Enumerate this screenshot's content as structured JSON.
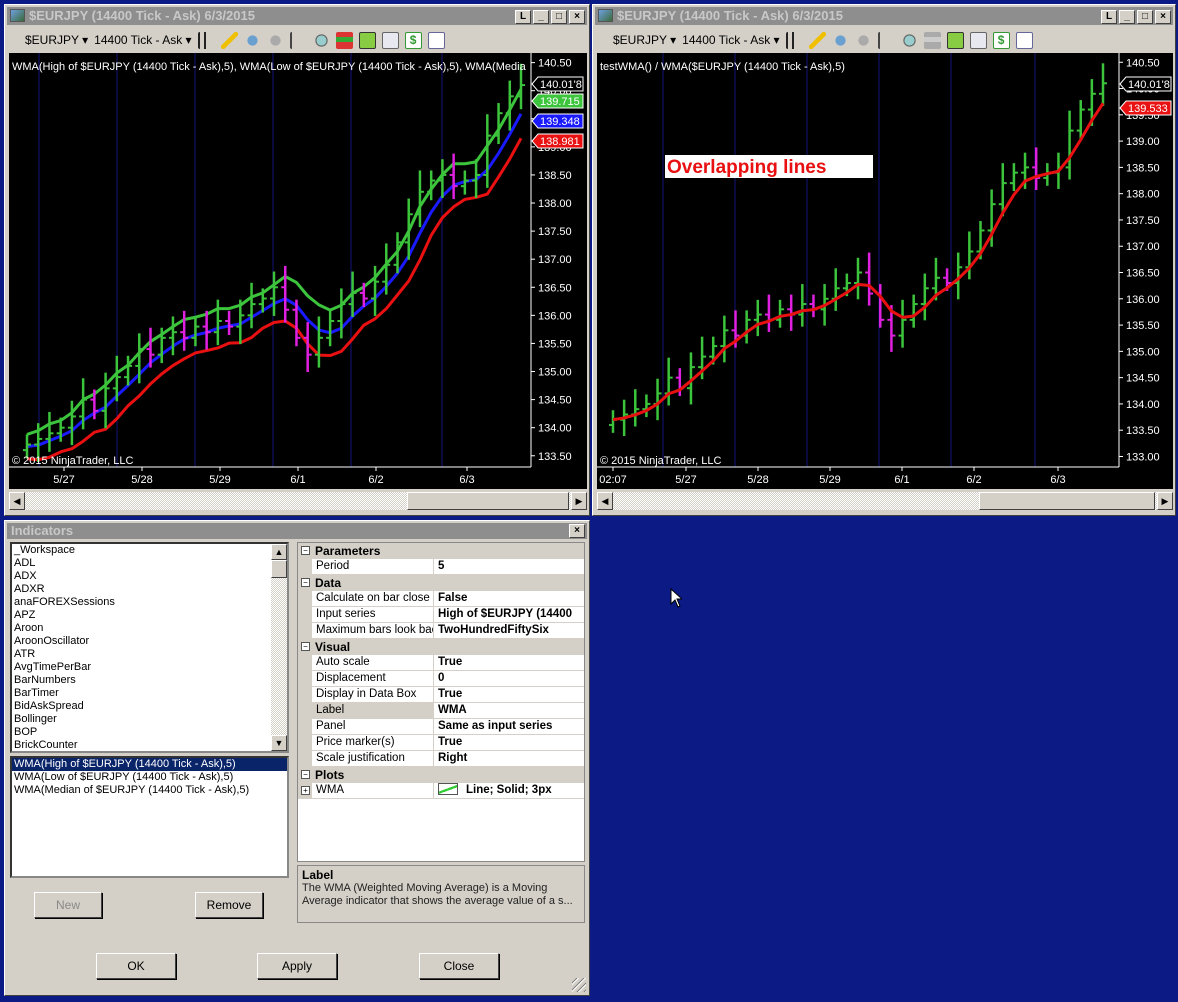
{
  "left_window": {
    "title": "$EURJPY (14400 Tick - Ask)  6/3/2015",
    "instrument": "$EURJPY",
    "interval": "14400 Tick - Ask",
    "legend": "WMA(High of $EURJPY (14400 Tick - Ask),5), WMA(Low of $EURJPY (14400 Tick - Ask),5), WMA(Media",
    "copyright": "© 2015 NinjaTrader, LLC",
    "price_markers": [
      {
        "text": "140.01'8",
        "color": "#000000"
      },
      {
        "text": "139.715",
        "color": "#3cc43c"
      },
      {
        "text": "139.348",
        "color": "#1a1aff"
      },
      {
        "text": "138.981",
        "color": "#e81010"
      }
    ]
  },
  "right_window": {
    "title": "$EURJPY (14400 Tick - Ask)  6/3/2015",
    "instrument": "$EURJPY",
    "interval": "14400 Tick - Ask",
    "legend": "testWMA() / WMA($EURJPY (14400 Tick - Ask),5)",
    "copyright": "© 2015 NinjaTrader, LLC",
    "annotation": "Overlapping lines",
    "price_markers": [
      {
        "text": "140.01'8",
        "color": "#000000"
      },
      {
        "text": "139.533",
        "color": "#e81010"
      }
    ]
  },
  "window_buttons": {
    "link": "L",
    "minimize": "_",
    "maximize": "□",
    "close": "×"
  },
  "chart_data": [
    {
      "type": "bar",
      "title": "WMA(High), WMA(Low), WMA(Median) of $EURJPY (14400 Tick - Ask), 5",
      "y_ticks": [
        "140.50",
        "140.00",
        "139.50",
        "139.00",
        "138.50",
        "138.00",
        "137.50",
        "137.00",
        "136.50",
        "136.00",
        "135.50",
        "135.00",
        "134.50",
        "134.00",
        "133.50"
      ],
      "ylim": [
        133.3,
        140.6
      ],
      "x_ticks": [
        "5/27",
        "5/28",
        "5/29",
        "6/1",
        "6/2",
        "6/3"
      ],
      "closes": [
        133.7,
        133.8,
        133.9,
        134.0,
        134.2,
        134.5,
        134.3,
        134.7,
        134.9,
        135.1,
        135.4,
        135.3,
        135.6,
        135.7,
        135.6,
        135.8,
        135.7,
        135.9,
        135.8,
        136.0,
        136.2,
        136.3,
        136.5,
        136.1,
        135.6,
        135.3,
        135.6,
        135.9,
        136.2,
        136.4,
        136.3,
        136.6,
        136.9,
        137.3,
        137.8,
        138.2,
        138.4,
        138.5,
        138.3,
        138.4,
        138.5,
        139.2,
        139.6,
        139.9,
        140.1
      ],
      "series": [
        {
          "name": "WMA High",
          "color": "#3cc43c"
        },
        {
          "name": "WMA Low",
          "color": "#e81010"
        },
        {
          "name": "WMA Median",
          "color": "#1a1aff"
        }
      ],
      "up_color": "#3cc43c",
      "down_color": "#e020e0",
      "grid": false
    },
    {
      "type": "bar",
      "title": "testWMA() / WMA($EURJPY (14400 Tick - Ask),5)",
      "y_ticks": [
        "140.50",
        "140.00",
        "139.50",
        "139.00",
        "138.50",
        "138.00",
        "137.50",
        "137.00",
        "136.50",
        "136.00",
        "135.50",
        "135.00",
        "134.50",
        "134.00",
        "133.50",
        "133.00"
      ],
      "ylim": [
        132.8,
        140.6
      ],
      "x_ticks": [
        "02:07",
        "5/27",
        "5/28",
        "5/29",
        "6/1",
        "6/2",
        "6/3"
      ],
      "series": [
        {
          "name": "WMA",
          "color": "#e81010"
        }
      ],
      "grid": false
    }
  ],
  "indicators": {
    "title": "Indicators",
    "available": [
      "_Workspace",
      "ADL",
      "ADX",
      "ADXR",
      "anaFOREXSessions",
      "APZ",
      "Aroon",
      "AroonOscillator",
      "ATR",
      "AvgTimePerBar",
      "BarNumbers",
      "BarTimer",
      "BidAskSpread",
      "Bollinger",
      "BOP",
      "BrickCounter"
    ],
    "applied": [
      "WMA(High of $EURJPY (14400 Tick - Ask),5)",
      "WMA(Low of $EURJPY (14400 Tick - Ask),5)",
      "WMA(Median of $EURJPY (14400 Tick - Ask),5)"
    ],
    "selected_index": 0,
    "buttons": {
      "new": "New",
      "remove": "Remove",
      "ok": "OK",
      "apply": "Apply",
      "close": "Close"
    },
    "properties": [
      {
        "category": "Parameters",
        "rows": [
          {
            "k": "Period",
            "v": "5"
          }
        ]
      },
      {
        "category": "Data",
        "rows": [
          {
            "k": "Calculate on bar close",
            "v": "False"
          },
          {
            "k": "Input series",
            "v": "High of $EURJPY (14400"
          },
          {
            "k": "Maximum bars look bac",
            "v": "TwoHundredFiftySix"
          }
        ]
      },
      {
        "category": "Visual",
        "rows": [
          {
            "k": "Auto scale",
            "v": "True"
          },
          {
            "k": "Displacement",
            "v": "0"
          },
          {
            "k": "Display in Data Box",
            "v": "True"
          },
          {
            "k": "Label",
            "v": "WMA"
          },
          {
            "k": "Panel",
            "v": "Same as input series"
          },
          {
            "k": "Price marker(s)",
            "v": "True"
          },
          {
            "k": "Scale justification",
            "v": "Right"
          }
        ]
      },
      {
        "category": "Plots",
        "rows": [
          {
            "k": "WMA",
            "v": "Line; Solid; 3px"
          }
        ]
      }
    ],
    "description_title": "Label",
    "description": "The WMA (Weighted Moving Average) is a Moving Average indicator that shows the average value of a s..."
  }
}
